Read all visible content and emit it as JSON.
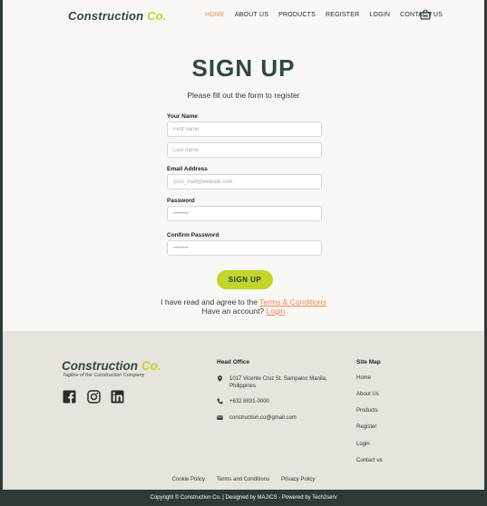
{
  "header": {
    "brand_main": "Construction",
    "brand_accent": "Co.",
    "nav": [
      "HOME",
      "ABOUT US",
      "PRODUCTS",
      "REGISTER",
      "LOGIN",
      "CONTACT US"
    ],
    "cart_icon": "basket-icon"
  },
  "form": {
    "title": "SIGN UP",
    "subtitle": "Please fill out the form to register",
    "name_label": "Your Name",
    "first_name_placeholder": "First name",
    "last_name_placeholder": "Last name",
    "email_label": "Email Address",
    "email_placeholder": "your_mail@website.com",
    "password_label": "Password",
    "password_placeholder": "••••••••",
    "confirm_label": "Confirm Password",
    "confirm_placeholder": "••••••••",
    "submit_label": "SIGN UP",
    "agree_text": "I have read and agree to the ",
    "terms_link": "Terms & Conditions",
    "account_text": "Have an account? ",
    "login_link": "Login"
  },
  "footer": {
    "brand_main": "Construction",
    "brand_accent": "Co.",
    "tagline": "Tagline of the Construction Company",
    "social": [
      "facebook-icon",
      "instagram-icon",
      "linkedin-icon"
    ],
    "head_office_title": "Head Office",
    "address": "1017 Vicente Cruz St. Sampaloc Manila, Philippines",
    "phone": "+632 8831-0000",
    "email": "construction.co@gmail.com",
    "sitemap_title": "Site Map",
    "sitemap": [
      "Home",
      "About Us",
      "Products",
      "Register",
      "Login",
      "Contact us"
    ],
    "policies": [
      "Cookie Policy",
      "Terms and Conditions",
      "Privacy Policy"
    ],
    "copyright": "Copyright © Construction Co. | Designed by MAJICS - Powered by Tech2serv"
  },
  "colors": {
    "brand_green": "#2e4a3e",
    "accent_lime": "#c3d52a",
    "link_orange": "#f1875a",
    "footer_bg": "#e7e3dd",
    "bottom_bar": "#2d3a35"
  }
}
